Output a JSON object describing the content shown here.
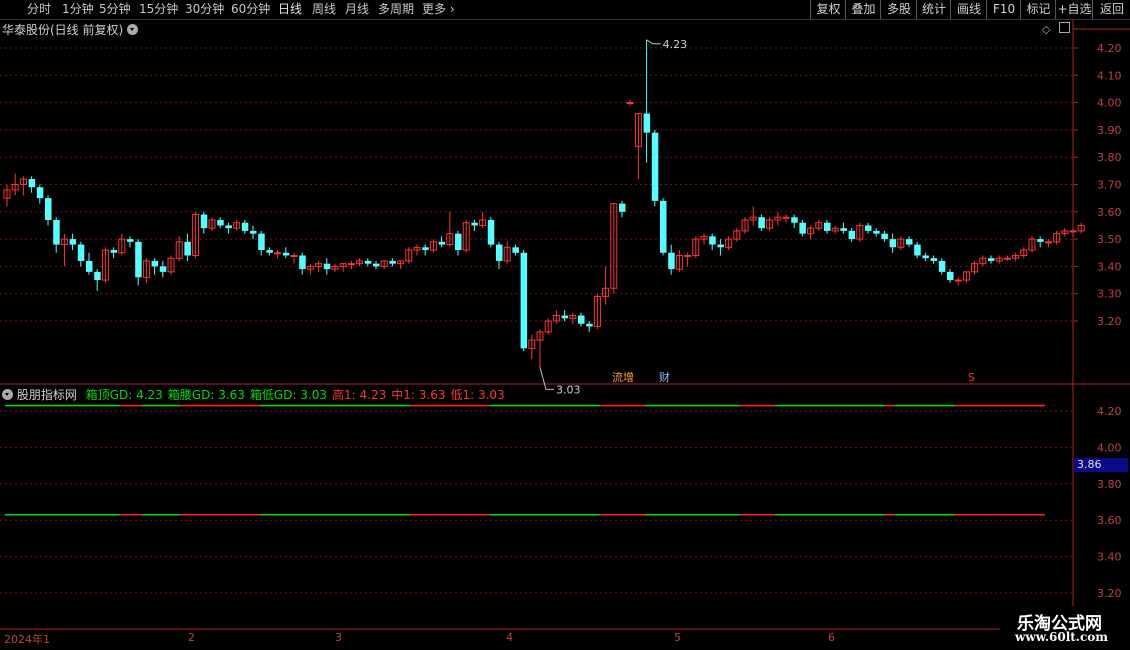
{
  "toolbar": {
    "periods": [
      "分时",
      "1分钟",
      "5分钟",
      "15分钟",
      "30分钟",
      "60分钟",
      "日线",
      "周线",
      "月线",
      "多周期",
      "更多"
    ],
    "active": "日线",
    "right_buttons": [
      "复权",
      "叠加",
      "多股",
      "统计",
      "画线",
      "F10",
      "标记",
      "+自选",
      "返回"
    ]
  },
  "main_chart": {
    "title": "华泰股份(日线 前复权)",
    "y_ticks": [
      "4.20",
      "4.10",
      "4.00",
      "3.90",
      "3.80",
      "3.70",
      "3.60",
      "3.50",
      "3.40",
      "3.30",
      "3.20"
    ],
    "high_marker": "4.23",
    "low_marker": "3.03",
    "events": [
      "增",
      "财",
      "S"
    ],
    "colors": {
      "up": "#ff3232",
      "down": "#54ffff",
      "grid": "#7a1010",
      "axis": "#b02020"
    }
  },
  "indicator": {
    "name": "股朋指标网",
    "labels": [
      {
        "text": "箱顶GD: 4.23",
        "color": "#00dd00"
      },
      {
        "text": "箱腰GD: 3.63",
        "color": "#00dd00"
      },
      {
        "text": "箱低GD: 3.03",
        "color": "#00dd00"
      },
      {
        "text": "高1: 4.23",
        "color": "#ff3232"
      },
      {
        "text": "中1: 3.63",
        "color": "#ff3232"
      },
      {
        "text": "低1: 3.03",
        "color": "#ff3232"
      }
    ],
    "y_ticks": [
      "4.20",
      "4.00",
      "3.80",
      "3.60",
      "3.40",
      "3.20"
    ],
    "highlight_value": "3.86"
  },
  "date_axis": {
    "labels": [
      "2024年1",
      "2",
      "3",
      "4",
      "5",
      "6"
    ]
  },
  "watermark": {
    "line1": "乐淘公式网",
    "line2": "www.60lt.com"
  },
  "chart_data": {
    "type": "candlestick",
    "title": "华泰股份(日线 前复权)",
    "ylim": [
      3.03,
      4.23
    ],
    "ohlc": [
      [
        3.65,
        3.7,
        3.62,
        3.68
      ],
      [
        3.68,
        3.74,
        3.66,
        3.7
      ],
      [
        3.7,
        3.73,
        3.66,
        3.72
      ],
      [
        3.72,
        3.73,
        3.67,
        3.69
      ],
      [
        3.69,
        3.7,
        3.63,
        3.65
      ],
      [
        3.65,
        3.66,
        3.55,
        3.57
      ],
      [
        3.57,
        3.58,
        3.45,
        3.48
      ],
      [
        3.48,
        3.52,
        3.4,
        3.5
      ],
      [
        3.5,
        3.52,
        3.46,
        3.48
      ],
      [
        3.48,
        3.49,
        3.4,
        3.42
      ],
      [
        3.42,
        3.45,
        3.37,
        3.38
      ],
      [
        3.38,
        3.39,
        3.31,
        3.35
      ],
      [
        3.35,
        3.47,
        3.34,
        3.46
      ],
      [
        3.46,
        3.47,
        3.43,
        3.45
      ],
      [
        3.45,
        3.52,
        3.44,
        3.5
      ],
      [
        3.5,
        3.51,
        3.47,
        3.49
      ],
      [
        3.49,
        3.5,
        3.33,
        3.36
      ],
      [
        3.36,
        3.43,
        3.34,
        3.42
      ],
      [
        3.42,
        3.43,
        3.37,
        3.4
      ],
      [
        3.4,
        3.42,
        3.36,
        3.38
      ],
      [
        3.38,
        3.44,
        3.37,
        3.43
      ],
      [
        3.43,
        3.51,
        3.42,
        3.49
      ],
      [
        3.49,
        3.52,
        3.42,
        3.44
      ],
      [
        3.44,
        3.6,
        3.43,
        3.59
      ],
      [
        3.59,
        3.6,
        3.52,
        3.54
      ],
      [
        3.54,
        3.58,
        3.53,
        3.57
      ],
      [
        3.57,
        3.58,
        3.54,
        3.55
      ],
      [
        3.55,
        3.56,
        3.52,
        3.54
      ],
      [
        3.54,
        3.57,
        3.53,
        3.56
      ],
      [
        3.56,
        3.57,
        3.52,
        3.53
      ],
      [
        3.53,
        3.55,
        3.5,
        3.52
      ],
      [
        3.52,
        3.53,
        3.44,
        3.46
      ],
      [
        3.46,
        3.47,
        3.44,
        3.45
      ],
      [
        3.45,
        3.46,
        3.43,
        3.45
      ],
      [
        3.45,
        3.47,
        3.43,
        3.44
      ],
      [
        3.44,
        3.45,
        3.41,
        3.44
      ],
      [
        3.44,
        3.45,
        3.37,
        3.39
      ],
      [
        3.39,
        3.41,
        3.37,
        3.4
      ],
      [
        3.4,
        3.42,
        3.38,
        3.41
      ],
      [
        3.41,
        3.43,
        3.37,
        3.39
      ],
      [
        3.39,
        3.41,
        3.38,
        3.4
      ],
      [
        3.4,
        3.41,
        3.38,
        3.41
      ],
      [
        3.41,
        3.42,
        3.39,
        3.41
      ],
      [
        3.41,
        3.43,
        3.4,
        3.42
      ],
      [
        3.42,
        3.43,
        3.4,
        3.41
      ],
      [
        3.41,
        3.42,
        3.39,
        3.4
      ],
      [
        3.4,
        3.42,
        3.39,
        3.42
      ],
      [
        3.42,
        3.43,
        3.4,
        3.41
      ],
      [
        3.41,
        3.42,
        3.39,
        3.42
      ],
      [
        3.42,
        3.47,
        3.41,
        3.46
      ],
      [
        3.46,
        3.48,
        3.44,
        3.47
      ],
      [
        3.47,
        3.48,
        3.44,
        3.46
      ],
      [
        3.46,
        3.5,
        3.45,
        3.49
      ],
      [
        3.49,
        3.51,
        3.47,
        3.48
      ],
      [
        3.48,
        3.6,
        3.47,
        3.52
      ],
      [
        3.52,
        3.53,
        3.44,
        3.46
      ],
      [
        3.46,
        3.57,
        3.45,
        3.56
      ],
      [
        3.56,
        3.57,
        3.53,
        3.55
      ],
      [
        3.55,
        3.6,
        3.54,
        3.57
      ],
      [
        3.57,
        3.58,
        3.47,
        3.48
      ],
      [
        3.48,
        3.49,
        3.39,
        3.42
      ],
      [
        3.42,
        3.49,
        3.41,
        3.47
      ],
      [
        3.47,
        3.48,
        3.44,
        3.45
      ],
      [
        3.45,
        3.46,
        3.09,
        3.1
      ],
      [
        3.1,
        3.15,
        3.06,
        3.13
      ],
      [
        3.13,
        3.17,
        3.03,
        3.16
      ],
      [
        3.16,
        3.21,
        3.15,
        3.2
      ],
      [
        3.2,
        3.24,
        3.19,
        3.22
      ],
      [
        3.22,
        3.24,
        3.2,
        3.21
      ],
      [
        3.21,
        3.23,
        3.19,
        3.22
      ],
      [
        3.22,
        3.23,
        3.18,
        3.19
      ],
      [
        3.19,
        3.2,
        3.16,
        3.18
      ],
      [
        3.18,
        3.3,
        3.17,
        3.29
      ],
      [
        3.29,
        3.4,
        3.26,
        3.32
      ],
      [
        3.32,
        3.63,
        3.3,
        3.63
      ],
      [
        3.63,
        3.64,
        3.58,
        3.6
      ],
      [
        4.0,
        4.01,
        3.99,
        4.0
      ],
      [
        3.84,
        3.96,
        3.72,
        3.96
      ],
      [
        3.96,
        4.23,
        3.78,
        3.89
      ],
      [
        3.89,
        3.9,
        3.62,
        3.64
      ],
      [
        3.64,
        3.65,
        3.44,
        3.45
      ],
      [
        3.45,
        3.48,
        3.37,
        3.39
      ],
      [
        3.39,
        3.46,
        3.38,
        3.44
      ],
      [
        3.44,
        3.45,
        3.4,
        3.44
      ],
      [
        3.44,
        3.51,
        3.43,
        3.5
      ],
      [
        3.5,
        3.52,
        3.48,
        3.51
      ],
      [
        3.51,
        3.52,
        3.46,
        3.48
      ],
      [
        3.48,
        3.5,
        3.44,
        3.47
      ],
      [
        3.47,
        3.51,
        3.46,
        3.5
      ],
      [
        3.5,
        3.54,
        3.49,
        3.53
      ],
      [
        3.53,
        3.58,
        3.52,
        3.57
      ],
      [
        3.57,
        3.62,
        3.55,
        3.58
      ],
      [
        3.58,
        3.59,
        3.53,
        3.54
      ],
      [
        3.54,
        3.58,
        3.53,
        3.57
      ],
      [
        3.57,
        3.6,
        3.55,
        3.58
      ],
      [
        3.58,
        3.59,
        3.56,
        3.58
      ],
      [
        3.58,
        3.59,
        3.54,
        3.56
      ],
      [
        3.56,
        3.57,
        3.51,
        3.52
      ],
      [
        3.52,
        3.55,
        3.5,
        3.54
      ],
      [
        3.54,
        3.57,
        3.53,
        3.56
      ],
      [
        3.56,
        3.57,
        3.52,
        3.53
      ],
      [
        3.53,
        3.55,
        3.52,
        3.54
      ],
      [
        3.54,
        3.56,
        3.52,
        3.53
      ],
      [
        3.53,
        3.54,
        3.49,
        3.5
      ],
      [
        3.5,
        3.56,
        3.49,
        3.55
      ],
      [
        3.55,
        3.56,
        3.52,
        3.53
      ],
      [
        3.53,
        3.54,
        3.51,
        3.52
      ],
      [
        3.52,
        3.53,
        3.49,
        3.5
      ],
      [
        3.5,
        3.52,
        3.45,
        3.47
      ],
      [
        3.47,
        3.51,
        3.46,
        3.5
      ],
      [
        3.5,
        3.51,
        3.47,
        3.48
      ],
      [
        3.48,
        3.49,
        3.43,
        3.44
      ],
      [
        3.44,
        3.45,
        3.42,
        3.43
      ],
      [
        3.43,
        3.44,
        3.41,
        3.42
      ],
      [
        3.42,
        3.43,
        3.37,
        3.38
      ],
      [
        3.38,
        3.39,
        3.34,
        3.35
      ],
      [
        3.35,
        3.36,
        3.33,
        3.35
      ],
      [
        3.35,
        3.38,
        3.34,
        3.38
      ],
      [
        3.38,
        3.42,
        3.37,
        3.41
      ],
      [
        3.41,
        3.44,
        3.4,
        3.43
      ],
      [
        3.43,
        3.44,
        3.41,
        3.42
      ],
      [
        3.42,
        3.44,
        3.41,
        3.43
      ],
      [
        3.43,
        3.44,
        3.42,
        3.43
      ],
      [
        3.43,
        3.45,
        3.42,
        3.44
      ],
      [
        3.44,
        3.47,
        3.43,
        3.46
      ],
      [
        3.46,
        3.51,
        3.45,
        3.5
      ],
      [
        3.5,
        3.51,
        3.47,
        3.49
      ],
      [
        3.49,
        3.5,
        3.47,
        3.49
      ],
      [
        3.49,
        3.53,
        3.48,
        3.52
      ],
      [
        3.52,
        3.54,
        3.51,
        3.53
      ],
      [
        3.53,
        3.54,
        3.51,
        3.53
      ],
      [
        3.53,
        3.56,
        3.52,
        3.55
      ]
    ],
    "indicator_series": [
      {
        "name": "箱顶GD",
        "values_const": 4.23
      },
      {
        "name": "箱腰GD",
        "values_const": 3.63
      },
      {
        "name": "箱低GD",
        "values_const": 3.03
      }
    ]
  }
}
